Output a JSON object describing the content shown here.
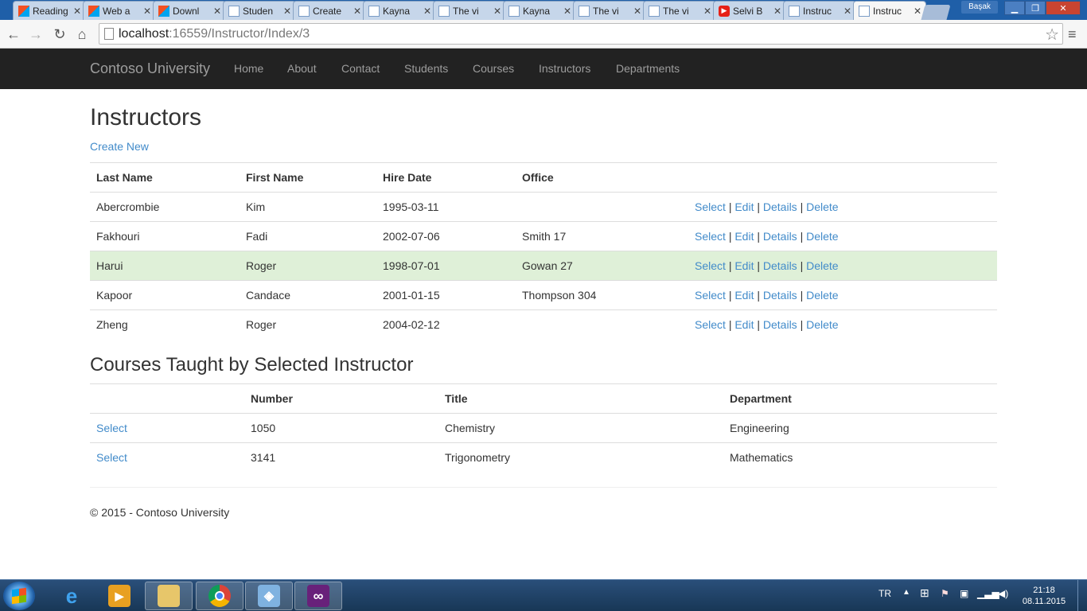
{
  "browser": {
    "tabs": [
      {
        "label": "Reading",
        "icon": "windows-icon"
      },
      {
        "label": "Web a",
        "icon": "windows-icon"
      },
      {
        "label": "Downl",
        "icon": "windows-icon"
      },
      {
        "label": "Studen",
        "icon": "page-icon"
      },
      {
        "label": "Create",
        "icon": "page-icon"
      },
      {
        "label": "Kayna",
        "icon": "page-icon"
      },
      {
        "label": "The vi",
        "icon": "page-icon"
      },
      {
        "label": "Kayna",
        "icon": "page-icon"
      },
      {
        "label": "The vi",
        "icon": "page-icon"
      },
      {
        "label": "The vi",
        "icon": "page-icon"
      },
      {
        "label": "Selvi B",
        "icon": "youtube-icon"
      },
      {
        "label": "Instruc",
        "icon": "page-icon"
      },
      {
        "label": "Instruc",
        "icon": "page-icon",
        "active": true
      }
    ],
    "user": "Başak",
    "url_host": "localhost",
    "url_path": ":16559/Instructor/Index/3"
  },
  "site": {
    "brand": "Contoso University",
    "nav": [
      "Home",
      "About",
      "Contact",
      "Students",
      "Courses",
      "Instructors",
      "Departments"
    ]
  },
  "page": {
    "title": "Instructors",
    "create_new": "Create New",
    "instructors_headers": [
      "Last Name",
      "First Name",
      "Hire Date",
      "Office"
    ],
    "instructors": [
      {
        "last": "Abercrombie",
        "first": "Kim",
        "hire": "1995-03-11",
        "office": ""
      },
      {
        "last": "Fakhouri",
        "first": "Fadi",
        "hire": "2002-07-06",
        "office": "Smith 17"
      },
      {
        "last": "Harui",
        "first": "Roger",
        "hire": "1998-07-01",
        "office": "Gowan 27",
        "selected": true
      },
      {
        "last": "Kapoor",
        "first": "Candace",
        "hire": "2001-01-15",
        "office": "Thompson 304"
      },
      {
        "last": "Zheng",
        "first": "Roger",
        "hire": "2004-02-12",
        "office": ""
      }
    ],
    "actions": {
      "select": "Select",
      "edit": "Edit",
      "details": "Details",
      "delete": "Delete",
      "sep": "|"
    },
    "courses_title": "Courses Taught by Selected Instructor",
    "courses_headers": [
      "",
      "Number",
      "Title",
      "Department"
    ],
    "courses": [
      {
        "select": "Select",
        "number": "1050",
        "title": "Chemistry",
        "department": "Engineering"
      },
      {
        "select": "Select",
        "number": "3141",
        "title": "Trigonometry",
        "department": "Mathematics"
      }
    ],
    "footer": "© 2015 - Contoso University"
  },
  "taskbar": {
    "lang": "TR",
    "time": "21:18",
    "date": "08.11.2015"
  },
  "colors": {
    "navbar": "#222222",
    "link": "#428bca",
    "selected_row": "#dff0d8"
  }
}
